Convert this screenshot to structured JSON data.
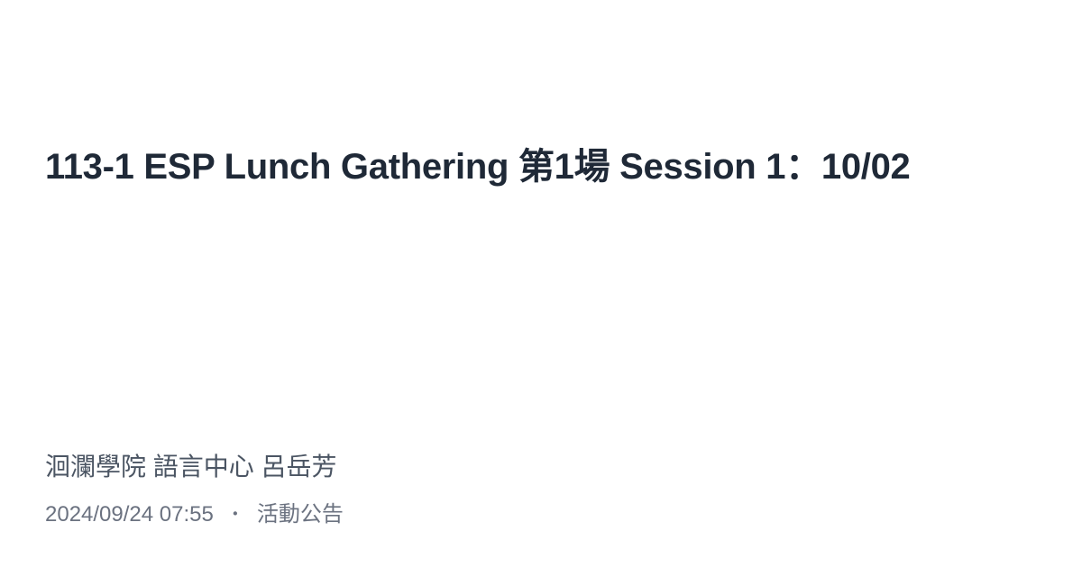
{
  "post": {
    "title": "113-1 ESP Lunch Gathering 第1場 Session 1：10/02",
    "author": "洄瀾學院 語言中心 呂岳芳",
    "date": "2024/09/24 07:55",
    "separator": "・",
    "category": "活動公告"
  },
  "colors": {
    "background": "#ffffff",
    "title": "#1f2937",
    "author": "#4b5563",
    "meta": "#6b7280"
  }
}
